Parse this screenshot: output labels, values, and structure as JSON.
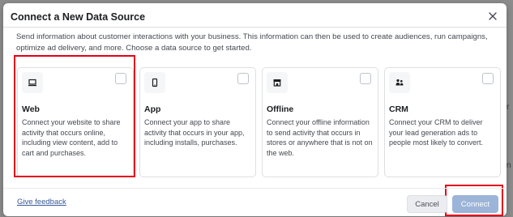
{
  "dialog": {
    "title": "Connect a New Data Source",
    "description": "Send information about customer interactions with your business. This information can then be used to create audiences, run campaigns, optimize ad delivery, and more. Choose a data source to get started."
  },
  "cards": [
    {
      "id": "web",
      "icon": "monitor-icon",
      "title": "Web",
      "description": "Connect your website to share activity that occurs online, including view content, add to cart and purchases.",
      "checked": false
    },
    {
      "id": "app",
      "icon": "mobile-phone-icon",
      "title": "App",
      "description": "Connect your app to share activity that occurs in your app, including installs, purchases.",
      "checked": false
    },
    {
      "id": "offline",
      "icon": "store-icon",
      "title": "Offline",
      "description": "Connect your offline information to send activity that occurs in stores or anywhere that is not on the web.",
      "checked": false
    },
    {
      "id": "crm",
      "icon": "people-icon",
      "title": "CRM",
      "description": "Connect your CRM to deliver your lead generation ads to people most likely to convert.",
      "checked": false
    }
  ],
  "footer": {
    "feedback_label": "Give feedback",
    "cancel_label": "Cancel",
    "connect_label": "Connect",
    "connect_enabled": false
  },
  "colors": {
    "highlight": "#e4001b",
    "link": "#385898",
    "connect_disabled": "#9cb4d8"
  }
}
